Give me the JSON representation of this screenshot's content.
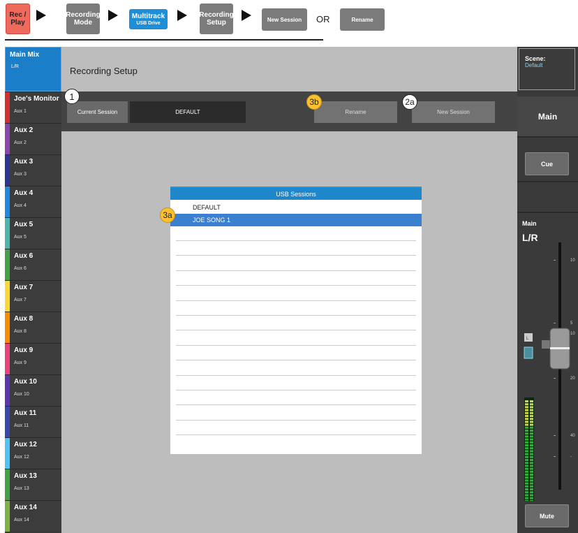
{
  "flow": {
    "rec_play": "Rec / Play",
    "recording_mode": "Recording Mode",
    "multitrack": "Multitrack",
    "multitrack_sub": "USB Drive",
    "recording_setup": "Recording Setup",
    "new_session": "New Session",
    "or": "OR",
    "rename": "Rename"
  },
  "sidebar": {
    "main_mix": {
      "label": "Main Mix",
      "sub": "L/R"
    },
    "items": [
      {
        "label": "Joe's Monitor",
        "sub": "Aux 1",
        "color": "#d32f2f"
      },
      {
        "label": "Aux 2",
        "sub": "Aux 2",
        "color": "#8e44ad"
      },
      {
        "label": "Aux 3",
        "sub": "Aux 3",
        "color": "#283593"
      },
      {
        "label": "Aux 4",
        "sub": "Aux 4",
        "color": "#1e88e5"
      },
      {
        "label": "Aux 5",
        "sub": "Aux 5",
        "color": "#4db6ac"
      },
      {
        "label": "Aux 6",
        "sub": "Aux 6",
        "color": "#43a047"
      },
      {
        "label": "Aux 7",
        "sub": "Aux 7",
        "color": "#fdd835"
      },
      {
        "label": "Aux 8",
        "sub": "Aux 8",
        "color": "#fb8c00"
      },
      {
        "label": "Aux 9",
        "sub": "Aux 9",
        "color": "#ec407a"
      },
      {
        "label": "Aux 10",
        "sub": "Aux 10",
        "color": "#5e35b1"
      },
      {
        "label": "Aux 11",
        "sub": "Aux 11",
        "color": "#3949ab"
      },
      {
        "label": "Aux 12",
        "sub": "Aux 12",
        "color": "#4fc3f7"
      },
      {
        "label": "Aux 13",
        "sub": "Aux 13",
        "color": "#43a047"
      },
      {
        "label": "Aux 14",
        "sub": "Aux 14",
        "color": "#7cb342"
      }
    ]
  },
  "header": {
    "title": "Recording Setup"
  },
  "toolbar": {
    "current_session_label": "Current Session",
    "current_session_value": "DEFAULT",
    "rename": "Rename",
    "new_session": "New Session"
  },
  "right_panel": {
    "scene_label": "Scene:",
    "scene_value": "Default",
    "main": "Main",
    "cue": "Cue",
    "main_lr_title": "Main",
    "main_lr_sub": "L/R",
    "mute": "Mute",
    "meter_l": "L",
    "scale": [
      "10",
      "5",
      "10",
      "20",
      "40",
      "-"
    ]
  },
  "dialog": {
    "title": "USB Sessions",
    "items": [
      "DEFAULT",
      "JOE SONG 1"
    ],
    "selected_index": 1
  },
  "callouts": {
    "c1": "1",
    "c2a": "2a",
    "c3a": "3a",
    "c3b": "3b"
  }
}
